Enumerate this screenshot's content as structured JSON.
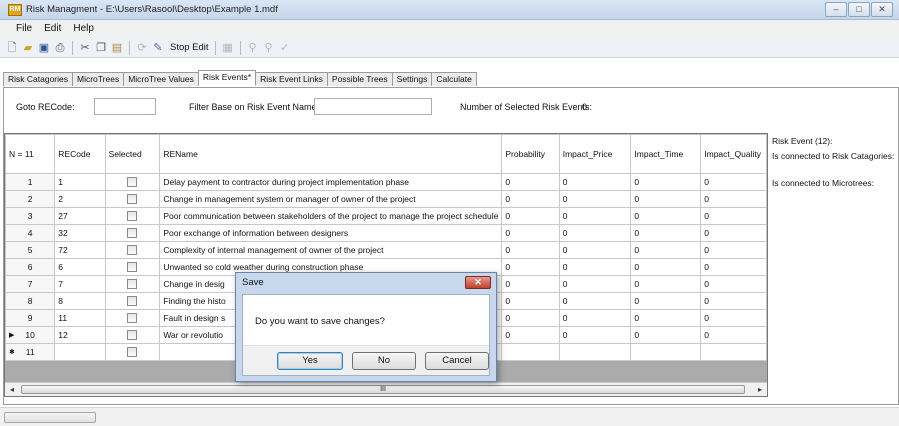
{
  "window": {
    "title": "Risk Managment - E:\\Users\\Rasool\\Desktop\\Example 1.mdf",
    "app_icon_text": "RM",
    "min_label": "–",
    "max_label": "□",
    "close_label": "✕"
  },
  "menu": [
    "File",
    "Edit",
    "Help"
  ],
  "toolbar": {
    "stop_edit_label": "Stop Edit",
    "icons": [
      "new-icon",
      "open-icon",
      "save-icon",
      "print-icon",
      "cut-icon",
      "copy-icon",
      "paste-icon",
      "refresh-icon",
      "stop-edit-icon",
      "grid-icon",
      "tool-a-icon",
      "tool-b-icon",
      "check-icon"
    ]
  },
  "tabs": [
    "Risk Catagories",
    "MicroTrees",
    "MicroTree Values",
    "Risk Events*",
    "Risk Event Links",
    "Possible Trees",
    "Settings",
    "Calculate"
  ],
  "active_tab": 3,
  "filters": {
    "goto_label": "Goto RECode:",
    "goto_value": "",
    "filter_label": "Filter Base on Risk Event Name:",
    "filter_value": "",
    "selected_count_label": "Number of Selected Risk Events:",
    "selected_count": "0"
  },
  "grid": {
    "row_header": "N = 11",
    "columns": [
      "RECode",
      "Selected",
      "REName",
      "Probability",
      "Impact_Price",
      "Impact_Time",
      "Impact_Quality"
    ],
    "rows": [
      {
        "n": "1",
        "code": "1",
        "selected": false,
        "name": "Delay payment to contractor during project implementation phase",
        "prob": "0",
        "price": "0",
        "time": "0",
        "quality": "0"
      },
      {
        "n": "2",
        "code": "2",
        "selected": false,
        "name": "Change in management system or manager of owner of the project",
        "prob": "0",
        "price": "0",
        "time": "0",
        "quality": "0"
      },
      {
        "n": "3",
        "code": "27",
        "selected": false,
        "name": "Poor communication between stakeholders of the project to manage the project schedule",
        "prob": "0",
        "price": "0",
        "time": "0",
        "quality": "0"
      },
      {
        "n": "4",
        "code": "32",
        "selected": false,
        "name": "Poor exchange of information between designers",
        "prob": "0",
        "price": "0",
        "time": "0",
        "quality": "0"
      },
      {
        "n": "5",
        "code": "72",
        "selected": false,
        "name": "Complexity of internal management of owner of the project",
        "prob": "0",
        "price": "0",
        "time": "0",
        "quality": "0"
      },
      {
        "n": "6",
        "code": "6",
        "selected": false,
        "name": "Unwanted so cold weather during construction phase",
        "prob": "0",
        "price": "0",
        "time": "0",
        "quality": "0"
      },
      {
        "n": "7",
        "code": "7",
        "selected": false,
        "name": "Change in desig",
        "prob": "0",
        "price": "0",
        "time": "0",
        "quality": "0"
      },
      {
        "n": "8",
        "code": "8",
        "selected": false,
        "name": "Finding the histo",
        "prob": "0",
        "price": "0",
        "time": "0",
        "quality": "0"
      },
      {
        "n": "9",
        "code": "11",
        "selected": false,
        "name": "Fault in design s",
        "prob": "0",
        "price": "0",
        "time": "0",
        "quality": "0"
      },
      {
        "n": "10",
        "code": "12",
        "selected": false,
        "name": "War or revolutio",
        "prob": "0",
        "price": "0",
        "time": "0",
        "quality": "0",
        "current": true
      },
      {
        "n": "11",
        "code": "",
        "selected": false,
        "name": "",
        "prob": "",
        "price": "",
        "time": "",
        "quality": "",
        "new": true
      }
    ],
    "scroll_thumb_label": "III"
  },
  "side_info": {
    "risk_event": "Risk Event (12):",
    "categories": "Is connected to Risk Catagories:",
    "microtrees": "Is connected to Microtrees:"
  },
  "dialog": {
    "title": "Save",
    "message": "Do you want to save changes?",
    "yes": "Yes",
    "no": "No",
    "cancel": "Cancel"
  }
}
